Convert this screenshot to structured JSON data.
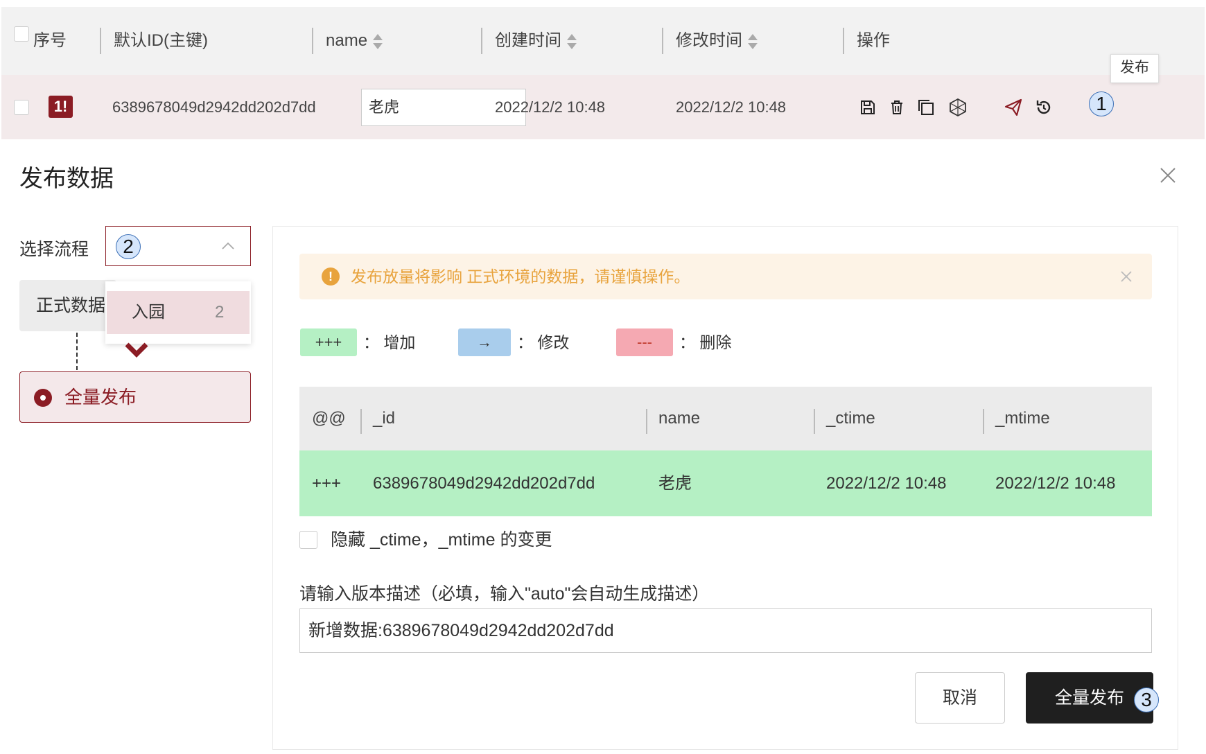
{
  "table": {
    "columns": {
      "index": "序号",
      "id": "默认ID(主键)",
      "name": "name",
      "ctime": "创建时间",
      "mtime": "修改时间",
      "ops": "操作"
    },
    "row": {
      "badge": "1!",
      "id": "6389678049d2942dd202d7dd",
      "name": "老虎",
      "ctime": "2022/12/2 10:48",
      "mtime": "2022/12/2 10:48"
    },
    "ops_icons": [
      "save-icon",
      "trash-icon",
      "copy-icon",
      "hexagon-icon",
      "send-icon",
      "history-icon"
    ],
    "tooltip": "发布"
  },
  "markers": {
    "m1": "1",
    "m2": "2",
    "m3": "3"
  },
  "dialog": {
    "title": "发布数据",
    "flow_label": "选择流程",
    "flow_option": {
      "label": "入园",
      "count": "2"
    },
    "stage_label": "正式数据",
    "publish_node": "全量发布",
    "warning": "发布放量将影响 正式环境的数据，请谨慎操作。",
    "legend": [
      {
        "symbol": "+++",
        "label": "增加",
        "color": "#b5f0c4"
      },
      {
        "symbol": "→",
        "label": "修改",
        "color": "#a9cdec"
      },
      {
        "symbol": "---",
        "label": "删除",
        "color": "#f5a9b2"
      }
    ],
    "legend_colon": "：",
    "diff": {
      "headers": [
        "@@",
        "_id",
        "name",
        "_ctime",
        "_mtime"
      ],
      "row": [
        "+++",
        "6389678049d2942dd202d7dd",
        "老虎",
        "2022/12/2 10:48",
        "2022/12/2 10:48"
      ]
    },
    "hide_label": "隐藏 _ctime，_mtime 的变更",
    "desc_label": "请输入版本描述（必填，输入\"auto\"会自动生成描述）",
    "desc_value": "新增数据:6389678049d2942dd202d7dd",
    "cancel": "取消",
    "submit": "全量发布"
  },
  "colors": {
    "accent": "#8b1c24",
    "warning": "#e8a33d",
    "add_row": "#b5f0c4"
  }
}
